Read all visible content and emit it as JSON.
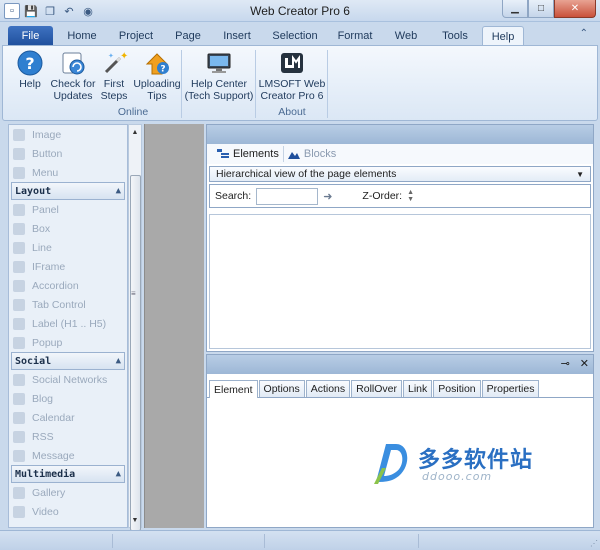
{
  "window": {
    "title": "Web Creator Pro 6"
  },
  "ribbon_tabs": {
    "file": "File",
    "home": "Home",
    "project": "Project",
    "page": "Page",
    "insert": "Insert",
    "selection": "Selection",
    "format": "Format",
    "web": "Web",
    "tools": "Tools",
    "help": "Help"
  },
  "ribbon": {
    "help": "Help",
    "check_updates_1": "Check for",
    "check_updates_2": "Updates",
    "first_steps_1": "First",
    "first_steps_2": "Steps",
    "uploading_tips_1": "Uploading",
    "uploading_tips_2": "Tips",
    "group_online": "Online",
    "help_center_1": "Help Center",
    "help_center_2": "(Tech Support)",
    "lmsoft_1": "LMSOFT Web",
    "lmsoft_2": "Creator Pro 6",
    "group_about": "About"
  },
  "toolbox": {
    "items_top": [
      "Image",
      "Button",
      "Menu"
    ],
    "section_layout": "Layout",
    "items_layout": [
      "Panel",
      "Box",
      "Line",
      "IFrame",
      "Accordion",
      "Tab Control",
      "Label (H1 .. H5)",
      "Popup"
    ],
    "section_social": "Social",
    "items_social": [
      "Social Networks",
      "Blog",
      "Calendar",
      "RSS",
      "Message"
    ],
    "section_multimedia": "Multimedia",
    "items_multimedia": [
      "Gallery",
      "Video"
    ]
  },
  "elements_panel": {
    "tab_elements": "Elements",
    "tab_blocks": "Blocks",
    "view_select": "Hierarchical view of the page elements",
    "search_label": "Search:",
    "search_value": "",
    "zorder_label": "Z-Order:"
  },
  "properties_panel": {
    "tabs": [
      "Element",
      "Options",
      "Actions",
      "RollOver",
      "Link",
      "Position",
      "Properties"
    ]
  },
  "watermark": {
    "cn": "多多软件站",
    "url": "ddooo.com"
  },
  "colors": {
    "file_tab": "#2a5fb0",
    "ribbon_bg": "#dbe7f5",
    "panel_header": "#a9c1de"
  }
}
